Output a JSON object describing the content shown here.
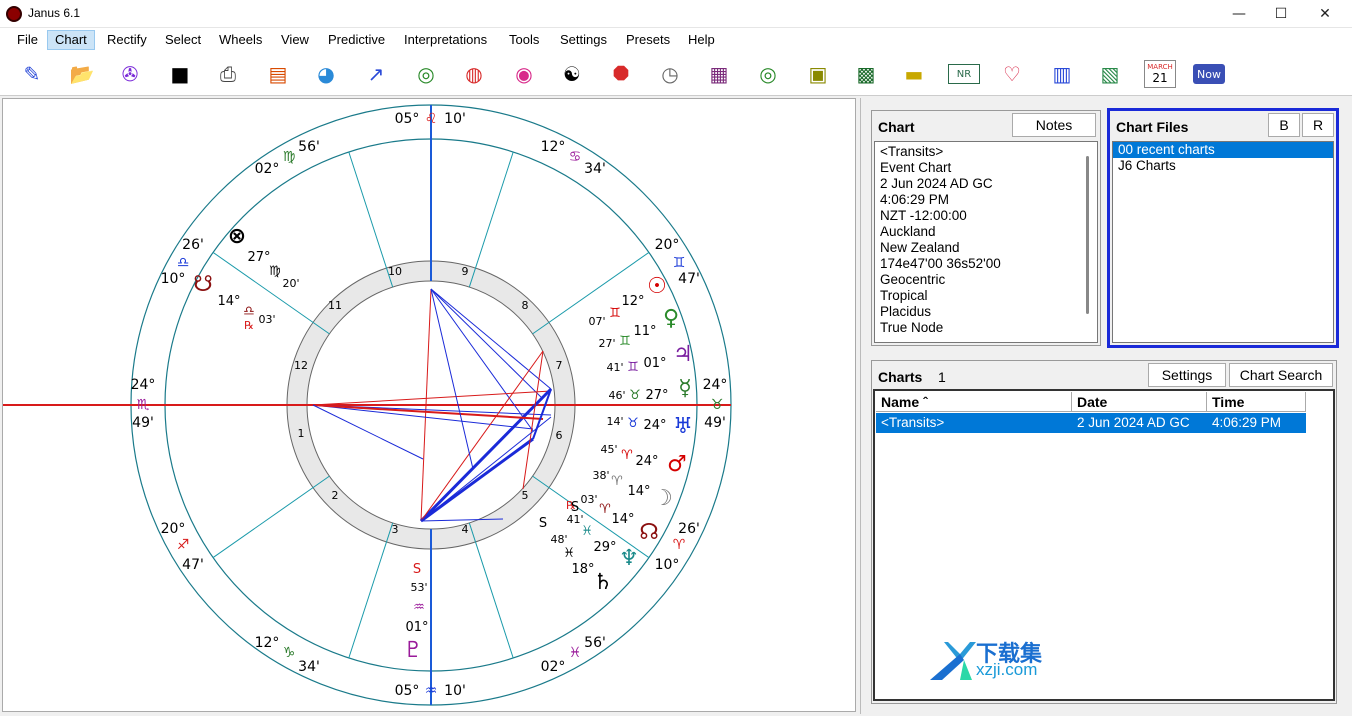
{
  "window": {
    "title": "Janus 6.1",
    "minimize": "—",
    "maximize": "☐",
    "close": "✕"
  },
  "menu": [
    "File",
    "Chart",
    "Rectify",
    "Select",
    "Wheels",
    "View",
    "Predictive",
    "Interpretations",
    "Tools",
    "Settings",
    "Presets",
    "Help"
  ],
  "toolbar": {
    "icons": [
      "open-chart-icon",
      "new-chart-icon",
      "wheel-zoom-icon",
      "save-icon",
      "print-icon",
      "chart-list-icon",
      "sign-wheel-icon",
      "transits-icon",
      "biwheel-icon",
      "transit-wheel-icon",
      "dial-icon",
      "yin-yang-icon",
      "octagon-icon",
      "clock-icon",
      "grid-icon",
      "target-icon",
      "square-grid-icon",
      "world-map-icon",
      "car-icon",
      "nr-icon",
      "hearts-icon",
      "table-icon",
      "graph-icon",
      "calendar-icon",
      "now-icon"
    ],
    "calendar_month": "MARCH",
    "calendar_day": "21",
    "nr_label": "NR",
    "now_label": "Now"
  },
  "wheel": {
    "cusp_labels": [
      {
        "text": "05°",
        "color": "#000"
      },
      {
        "text": "10'",
        "color": "#000"
      },
      {
        "text": "12°",
        "color": "#000"
      },
      {
        "text": "34'",
        "color": "#000"
      },
      {
        "text": "20°",
        "color": "#000"
      },
      {
        "text": "47'",
        "color": "#000"
      },
      {
        "text": "24°",
        "color": "#000"
      },
      {
        "text": "49'",
        "color": "#000"
      },
      {
        "text": "26'",
        "color": "#000"
      },
      {
        "text": "10°",
        "color": "#000"
      },
      {
        "text": "56'",
        "color": "#000"
      },
      {
        "text": "02°",
        "color": "#000"
      },
      {
        "text": "05°",
        "color": "#000"
      },
      {
        "text": "10'",
        "color": "#000"
      },
      {
        "text": "12°",
        "color": "#000"
      },
      {
        "text": "34'",
        "color": "#000"
      },
      {
        "text": "20°",
        "color": "#000"
      },
      {
        "text": "47'",
        "color": "#000"
      },
      {
        "text": "24°",
        "color": "#000"
      },
      {
        "text": "49'",
        "color": "#000"
      },
      {
        "text": "26'",
        "color": "#000"
      },
      {
        "text": "10°",
        "color": "#000"
      },
      {
        "text": "56'",
        "color": "#000"
      },
      {
        "text": "02°",
        "color": "#000"
      }
    ],
    "sign_glyphs": [
      "♌",
      "♋",
      "♊",
      "♉",
      "♈",
      "♓",
      "♒",
      "♑",
      "♐",
      "♏",
      "♎",
      "♍"
    ],
    "house_numbers": [
      "1",
      "2",
      "3",
      "4",
      "5",
      "6",
      "7",
      "8",
      "9",
      "10",
      "11",
      "12"
    ],
    "planets": [
      {
        "glyph": "☉",
        "deg": "12°",
        "min": "07'",
        "sign": "♊",
        "color": "#d40000"
      },
      {
        "glyph": "♀",
        "deg": "11°",
        "min": "27'",
        "sign": "♊",
        "color": "#2a8a2a"
      },
      {
        "glyph": "♃",
        "deg": "01°",
        "min": "41'",
        "sign": "♊",
        "color": "#7a1fa0"
      },
      {
        "glyph": "☿",
        "deg": "27°",
        "min": "46'",
        "sign": "♉",
        "color": "#2a7a2a"
      },
      {
        "glyph": "♅",
        "deg": "24°",
        "min": "14'",
        "sign": "♉",
        "color": "#1a3ad8"
      },
      {
        "glyph": "♂",
        "deg": "24°",
        "min": "45'",
        "sign": "♈",
        "color": "#d40000"
      },
      {
        "glyph": "☽",
        "deg": "14°",
        "min": "38'",
        "sign": "♈",
        "color": "#777"
      },
      {
        "glyph": "☊",
        "deg": "14°",
        "min": "03'",
        "sign": "♈",
        "retro": "℞",
        "color": "#8b1010"
      },
      {
        "glyph": "♆",
        "deg": "29°",
        "min": "41'",
        "sign": "♓",
        "color": "#1a8a8a"
      },
      {
        "glyph": "♄",
        "deg": "18°",
        "min": "48'",
        "sign": "♓",
        "color": "#000"
      },
      {
        "glyph": "♇",
        "deg": "01°",
        "min": "53'",
        "sign": "♒",
        "color": "#9a1a9a"
      },
      {
        "glyph": "⊗",
        "deg": "27°",
        "min": "20'",
        "sign": "♍",
        "color": "#000"
      },
      {
        "glyph": "☋",
        "deg": "14°",
        "min": "03'",
        "sign": "♎",
        "retro": "℞",
        "color": "#8b1010"
      }
    ],
    "station_labels": [
      "S",
      "S",
      "S"
    ]
  },
  "chart_panel": {
    "title": "Chart",
    "notes_button": "Notes",
    "lines": [
      "<Transits>",
      "Event Chart",
      "2 Jun 2024 AD GC",
      "4:06:29 PM",
      "NZT -12:00:00",
      "Auckland",
      "New Zealand",
      "174e47'00 36s52'00",
      "Geocentric",
      "Tropical",
      "Placidus",
      "True Node"
    ]
  },
  "chart_files": {
    "title": "Chart Files",
    "b_button": "B",
    "r_button": "R",
    "items": [
      "00 recent charts",
      "J6 Charts"
    ]
  },
  "charts_panel": {
    "title": "Charts",
    "count": "1",
    "settings_button": "Settings",
    "search_button": "Chart Search",
    "columns": [
      "Name ˆ",
      "Date",
      "Time"
    ],
    "rows": [
      [
        "<Transits>",
        "2 Jun 2024 AD GC",
        "4:06:29 PM"
      ]
    ]
  },
  "watermark": {
    "text": "下载集",
    "url": "xzji.com"
  }
}
